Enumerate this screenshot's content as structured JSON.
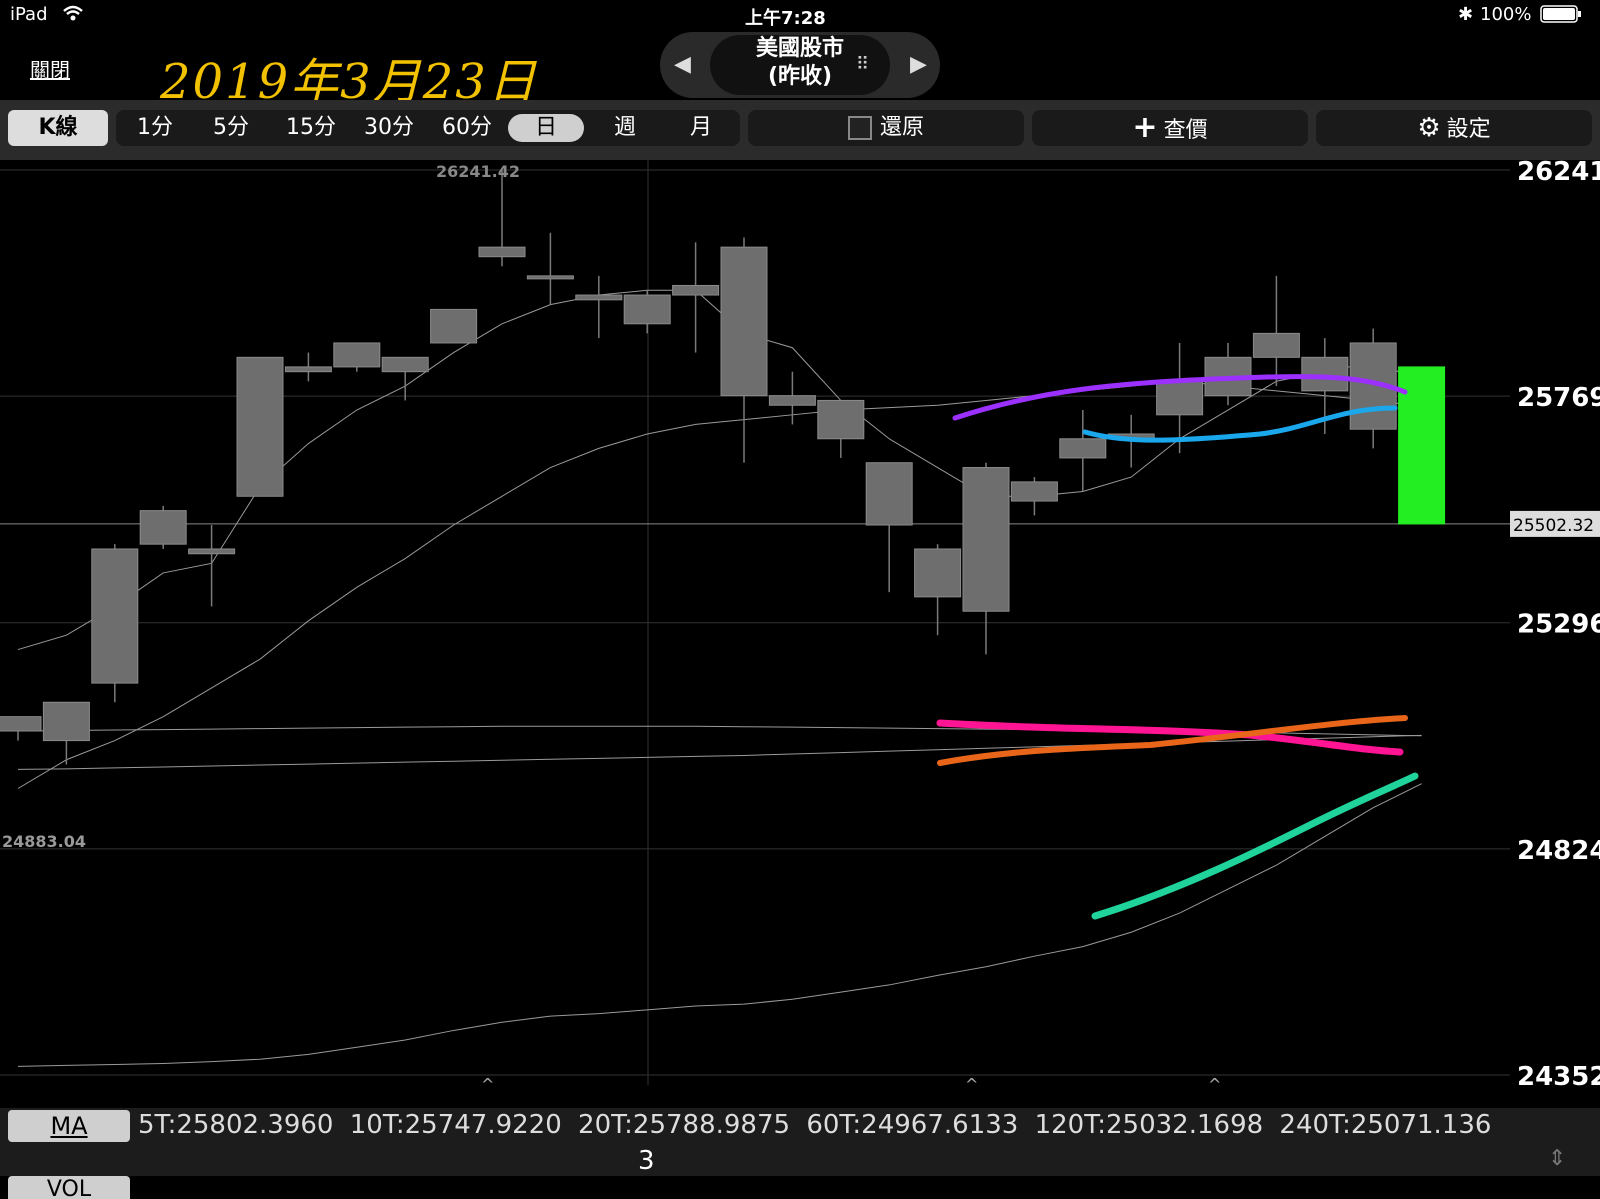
{
  "status": {
    "device": "iPad",
    "time": "上午7:28",
    "battery": "100%"
  },
  "header": {
    "close_label": "關閉",
    "handwritten_date": "2019年3月23日",
    "market_line1": "美國股市",
    "market_line2": "(昨收)"
  },
  "toolbar": {
    "k_label": "K線",
    "periods": [
      "1分",
      "5分",
      "15分",
      "30分",
      "60分",
      "日",
      "週",
      "月"
    ],
    "active_period": "日",
    "restore_label": "還原",
    "price_label": "查價",
    "settings_label": "設定"
  },
  "chart_data": {
    "type": "candlestick",
    "price_labels": [
      "26241",
      "25769",
      "25502.32",
      "25296",
      "24824",
      "24352"
    ],
    "high_label": "26241.42",
    "low_label": "24883.04",
    "reference_price": 25502.32,
    "ylim": [
      24352,
      26241
    ],
    "candles": [
      {
        "open": 25070,
        "high": 25100,
        "low": 25050,
        "close": 25100
      },
      {
        "open": 25050,
        "high": 25130,
        "low": 25000,
        "close": 25130
      },
      {
        "open": 25170,
        "high": 25460,
        "low": 25130,
        "close": 25450
      },
      {
        "open": 25460,
        "high": 25540,
        "low": 25450,
        "close": 25530
      },
      {
        "open": 25450,
        "high": 25500,
        "low": 25330,
        "close": 25440
      },
      {
        "open": 25560,
        "high": 25850,
        "low": 25560,
        "close": 25850
      },
      {
        "open": 25820,
        "high": 25860,
        "low": 25800,
        "close": 25830
      },
      {
        "open": 25830,
        "high": 25870,
        "low": 25820,
        "close": 25880
      },
      {
        "open": 25820,
        "high": 25850,
        "low": 25760,
        "close": 25850
      },
      {
        "open": 25880,
        "high": 25950,
        "low": 25880,
        "close": 25950
      },
      {
        "open": 26060,
        "high": 26241,
        "low": 26040,
        "close": 26080
      },
      {
        "open": 26020,
        "high": 26110,
        "low": 25960,
        "close": 26020
      },
      {
        "open": 25980,
        "high": 26020,
        "low": 25890,
        "close": 25970
      },
      {
        "open": 25980,
        "high": 25990,
        "low": 25900,
        "close": 25920
      },
      {
        "open": 25980,
        "high": 26090,
        "low": 25860,
        "close": 26000
      },
      {
        "open": 26080,
        "high": 26100,
        "low": 25630,
        "close": 25770
      },
      {
        "open": 25770,
        "high": 25820,
        "low": 25710,
        "close": 25750
      },
      {
        "open": 25760,
        "high": 25760,
        "low": 25640,
        "close": 25680
      },
      {
        "open": 25630,
        "high": 25630,
        "low": 25360,
        "close": 25500
      },
      {
        "open": 25450,
        "high": 25460,
        "low": 25270,
        "close": 25350
      },
      {
        "open": 25620,
        "high": 25630,
        "low": 25230,
        "close": 25320
      },
      {
        "open": 25550,
        "high": 25600,
        "low": 25520,
        "close": 25590
      },
      {
        "open": 25640,
        "high": 25740,
        "low": 25570,
        "close": 25680
      },
      {
        "open": 25680,
        "high": 25730,
        "low": 25620,
        "close": 25690
      },
      {
        "open": 25730,
        "high": 25880,
        "low": 25650,
        "close": 25800
      },
      {
        "open": 25770,
        "high": 25880,
        "low": 25750,
        "close": 25850
      },
      {
        "open": 25850,
        "high": 26020,
        "low": 25790,
        "close": 25900
      },
      {
        "open": 25850,
        "high": 25890,
        "low": 25690,
        "close": 25780
      },
      {
        "open": 25700,
        "high": 25910,
        "low": 25660,
        "close": 25880
      },
      {
        "open": 25830,
        "high": 25830,
        "low": 25810,
        "close": 25502.32
      }
    ],
    "ma_lines": [
      {
        "name": "5T",
        "values": [
          25240,
          25270,
          25330,
          25400,
          25420,
          25580,
          25670,
          25740,
          25790,
          25860,
          25920,
          25960,
          25980,
          25990,
          25990,
          25900,
          25870,
          25760,
          25680,
          25620,
          25560,
          25560,
          25570,
          25600,
          25680,
          25740,
          25800,
          25820,
          25840,
          25802
        ]
      },
      {
        "name": "10T",
        "values": [
          24950,
          25010,
          25050,
          25100,
          25160,
          25220,
          25300,
          25370,
          25430,
          25500,
          25560,
          25620,
          25660,
          25690,
          25710,
          25720,
          25730,
          25740,
          25745,
          25750,
          25760,
          25770,
          25780,
          25790,
          25800,
          25790,
          25780,
          25770,
          25760,
          25748
        ]
      },
      {
        "name": "20T",
        "values": [
          25070,
          25071,
          25072,
          25073,
          25074,
          25075,
          25076,
          25077,
          25078,
          25079,
          25080,
          25080,
          25080,
          25080,
          25080,
          25079,
          25078,
          25077,
          25076,
          25075,
          25074,
          25073,
          25072,
          25071,
          25070,
          25068,
          25066,
          25064,
          25062,
          25060
        ]
      },
      {
        "name": "60T",
        "values": [
          24990,
          24991,
          24993,
          24995,
          24997,
          24999,
          25001,
          25003,
          25005,
          25007,
          25009,
          25011,
          25013,
          25015,
          25017,
          25019,
          25022,
          25025,
          25028,
          25031,
          25034,
          25037,
          25040,
          25043,
          25046,
          25049,
          25052,
          25055,
          25058,
          25061
        ]
      },
      {
        "name": "120T",
        "values": [
          24370,
          24372,
          24374,
          24376,
          24380,
          24385,
          24395,
          24410,
          24425,
          24445,
          24462,
          24475,
          24480,
          24488,
          24496,
          24500,
          24510,
          24525,
          24540,
          24560,
          24578,
          24600,
          24620,
          24650,
          24690,
          24740,
          24790,
          24850,
          24910,
          24960
        ]
      }
    ]
  },
  "ma_footer": {
    "label": "MA",
    "values": [
      "5T:25802.3960",
      "10T:25747.9220",
      "20T:25788.9875",
      "60T:24967.6133",
      "120T:25032.1698",
      "240T:25071.136"
    ]
  },
  "page_number": "3",
  "vol_label": "VOL"
}
